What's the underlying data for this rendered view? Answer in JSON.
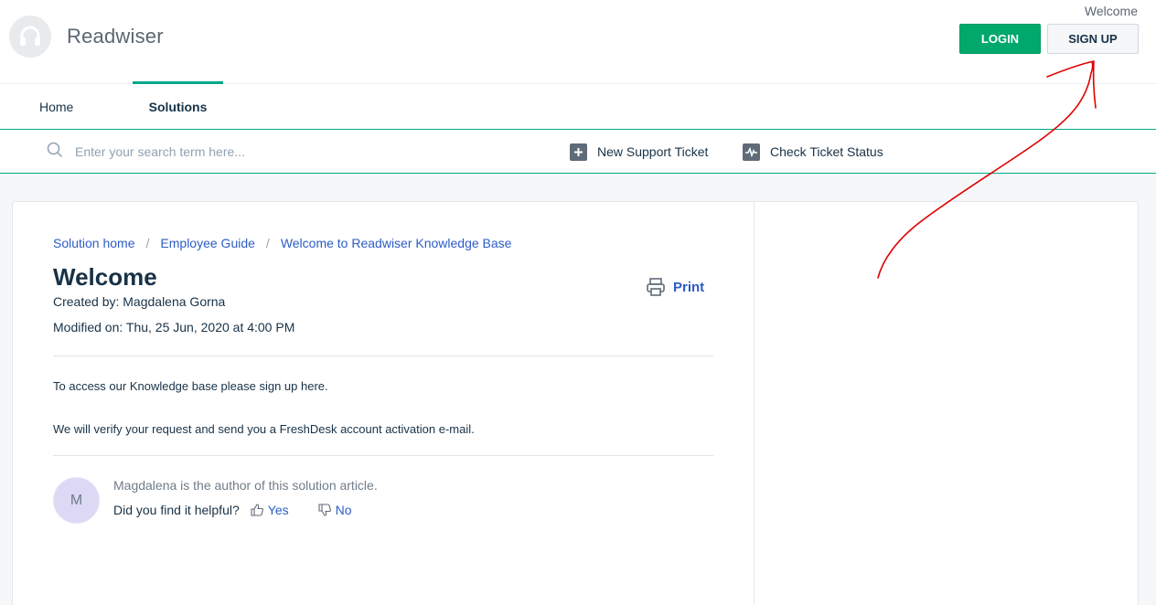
{
  "header": {
    "brand": "Readwiser",
    "welcome": "Welcome",
    "login_label": "LOGIN",
    "signup_label": "SIGN UP"
  },
  "nav": {
    "tabs": [
      {
        "label": "Home",
        "active": false
      },
      {
        "label": "Solutions",
        "active": true
      }
    ]
  },
  "search": {
    "placeholder": "Enter your search term here...",
    "actions": [
      {
        "label": "New Support Ticket",
        "icon": "plus-icon"
      },
      {
        "label": "Check Ticket Status",
        "icon": "pulse-icon"
      }
    ]
  },
  "breadcrumb": [
    "Solution home",
    "Employee Guide",
    "Welcome to Readwiser Knowledge Base"
  ],
  "article": {
    "title": "Welcome",
    "created_by": "Created by: Magdalena Gorna",
    "modified_on": "Modified on: Thu, 25 Jun, 2020 at 4:00 PM",
    "print_label": "Print",
    "paragraphs": [
      "To access our Knowledge base please sign up here.",
      "We will verify your request and send you a FreshDesk account activation e-mail."
    ]
  },
  "feedback": {
    "avatar_initial": "M",
    "author_note": "Magdalena is the author of this solution article.",
    "question": "Did you find it helpful?",
    "yes_label": "Yes",
    "no_label": "No"
  },
  "colors": {
    "accent_green": "#00a886",
    "login_green": "#00a86b",
    "link_blue": "#2c5cc5",
    "annotation_red": "#e00000"
  }
}
